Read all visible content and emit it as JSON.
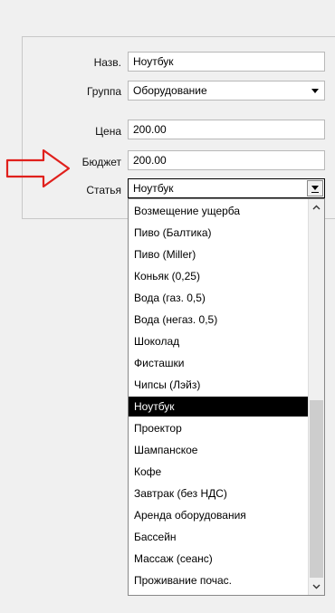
{
  "form": {
    "name_label": "Назв.",
    "name_value": "Ноутбук",
    "group_label": "Группа",
    "group_value": "Оборудование",
    "price_label": "Цена",
    "price_value": "200.00",
    "budget_label": "Бюджет",
    "budget_value": "200.00",
    "article_label": "Статья",
    "article_value": "Ноутбук"
  },
  "dropdown": {
    "items": [
      "Возмещение ущерба",
      "Пиво (Балтика)",
      "Пиво (Miller)",
      "Коньяк (0,25)",
      "Вода (газ. 0,5)",
      "Вода (негаз. 0,5)",
      "Шоколад",
      "Фисташки",
      "Чипсы (Лэйз)",
      "Ноутбук",
      "Проектор",
      "Шампанское",
      "Кофе",
      "Завтрак (без НДС)",
      "Аренда оборудования",
      "Бассейн",
      "Массаж (сеанс)",
      "Проживание почас."
    ],
    "selected_index": 9
  },
  "colors": {
    "arrow": "#e0201c",
    "selection": "#000000",
    "background": "#f0f0f0"
  },
  "icons": {
    "pointer": "red-arrow-icon",
    "combo": "chevron-down-icon"
  }
}
